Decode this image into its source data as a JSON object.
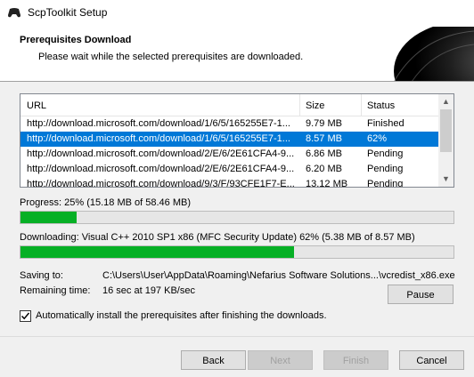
{
  "window": {
    "title": "ScpToolkit Setup",
    "icon": "gamepad-icon"
  },
  "header": {
    "title": "Prerequisites Download",
    "subtitle": "Please wait while the selected prerequisites are downloaded."
  },
  "downloads": {
    "columns": [
      "URL",
      "Size",
      "Status"
    ],
    "rows": [
      {
        "url": "http://download.microsoft.com/download/1/6/5/165255E7-1...",
        "size": "9.79 MB",
        "status": "Finished",
        "selected": false
      },
      {
        "url": "http://download.microsoft.com/download/1/6/5/165255E7-1...",
        "size": "8.57 MB",
        "status": "62%",
        "selected": true
      },
      {
        "url": "http://download.microsoft.com/download/2/E/6/2E61CFA4-9...",
        "size": "6.86 MB",
        "status": "Pending",
        "selected": false
      },
      {
        "url": "http://download.microsoft.com/download/2/E/6/2E61CFA4-9...",
        "size": "6.20 MB",
        "status": "Pending",
        "selected": false
      },
      {
        "url": "http://download.microsoft.com/download/9/3/F/93CFE1F7-E...",
        "size": "13.12 MB",
        "status": "Pending",
        "selected": false
      }
    ]
  },
  "progress": {
    "label": "Progress: 25% (15.18 MB of 58.46 MB)",
    "fraction": 0.25
  },
  "downloading": {
    "label": "Downloading: Visual C++ 2010 SP1 x86 (MFC Security Update) 62%  (5.38 MB of 8.57 MB)",
    "fraction": 0.62
  },
  "details": {
    "saving_to_label": "Saving to:",
    "saving_to_value": "C:\\Users\\User\\AppData\\Roaming\\Nefarius Software Solutions...\\vcredist_x86.exe",
    "remaining_label": "Remaining time:",
    "remaining_value": "16 sec at 197 KB/sec"
  },
  "pause_label": "Pause",
  "auto_install": {
    "label": "Automatically install the prerequisites after finishing the downloads.",
    "checked": true
  },
  "footer": {
    "back": "Back",
    "next": "Next",
    "finish": "Finish",
    "cancel": "Cancel"
  },
  "colors": {
    "progress_fill": "#06b025",
    "selection": "#0078d7"
  }
}
